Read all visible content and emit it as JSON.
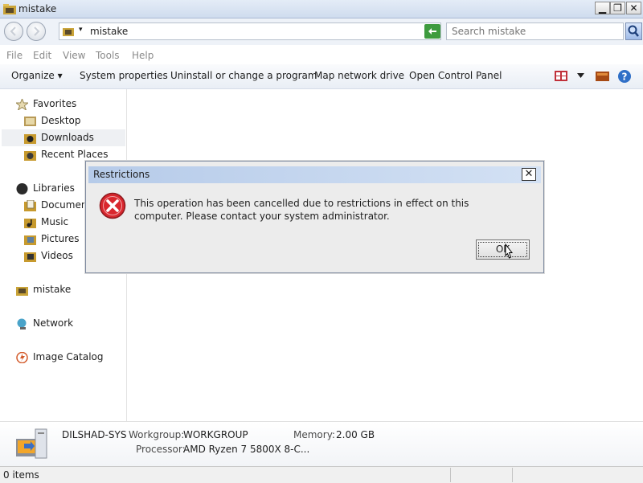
{
  "window": {
    "title": "mistake",
    "icon": "folder-icon",
    "buttons": {
      "minimize": "▁",
      "maximize": "❐",
      "close": "✕"
    }
  },
  "address": {
    "crumb_arrow": "▾",
    "path": "mistake",
    "dropdown": "▼",
    "search_placeholder": "Search mistake"
  },
  "menu": [
    "File",
    "Edit",
    "View",
    "Tools",
    "Help"
  ],
  "commands": {
    "organize": "Organize ▾",
    "system_properties": "System properties",
    "uninstall": "Uninstall or change a program",
    "map_drive": "Map network drive",
    "control_panel": "Open Control Panel"
  },
  "nav": {
    "favorites": "Favorites",
    "desktop": "Desktop",
    "downloads": "Downloads",
    "recent": "Recent Places",
    "libraries": "Libraries",
    "documents": "Documents",
    "music": "Music",
    "pictures": "Pictures",
    "videos": "Videos",
    "computer": "mistake",
    "network": "Network",
    "image_catalog": "Image Catalog"
  },
  "details": {
    "computer_name": "DILSHAD-SYS",
    "workgroup_label": "Workgroup:",
    "workgroup_value": "WORKGROUP",
    "memory_label": "Memory:",
    "memory_value": "2.00 GB",
    "processor_label": "Processor:",
    "processor_value": "AMD Ryzen 7 5800X 8-C..."
  },
  "status": {
    "items": "0 items"
  },
  "dialog": {
    "title": "Restrictions",
    "close": "✕",
    "message": "This operation has been cancelled due to restrictions in effect on this computer. Please contact your system administrator.",
    "ok": "OK",
    "icon": "error-icon"
  },
  "colors": {
    "accent": "#3a6fc4",
    "error": "#d9272e"
  }
}
